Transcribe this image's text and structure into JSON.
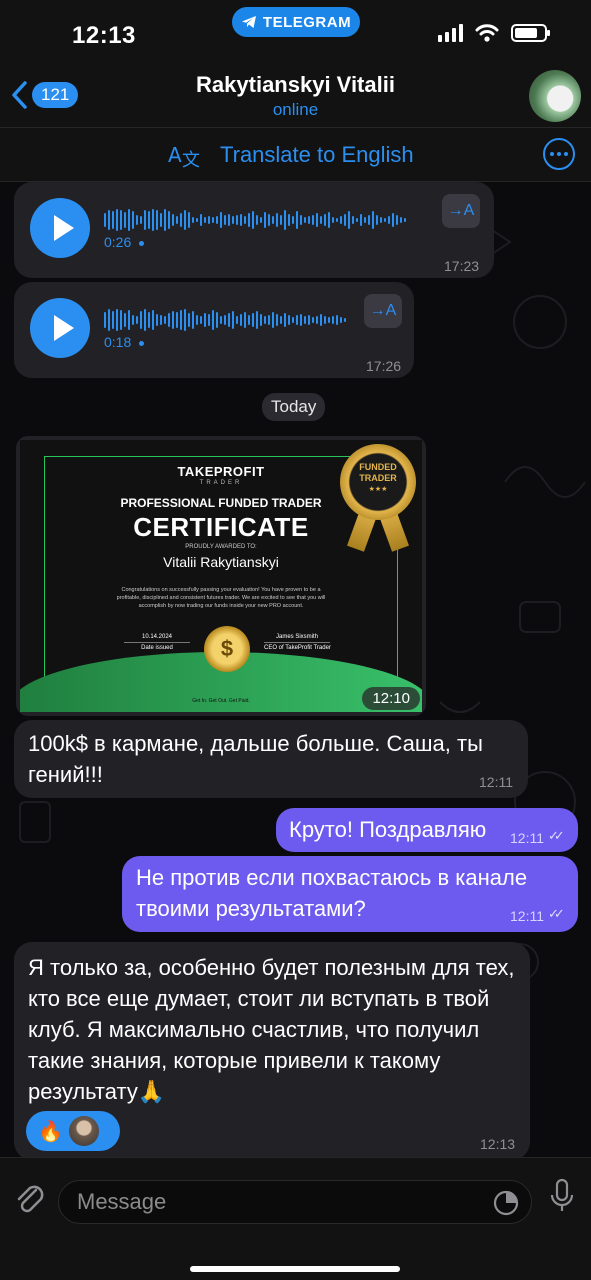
{
  "status": {
    "time": "12:13",
    "app_pill": "TELEGRAM"
  },
  "header": {
    "back_count": "121",
    "title": "Rakytianskyi Vitalii",
    "status": "online"
  },
  "translate_bar": {
    "label": "Translate to English"
  },
  "voice_messages": [
    {
      "duration": "0:26",
      "time": "17:23",
      "translate": "→A"
    },
    {
      "duration": "0:18",
      "time": "17:26",
      "translate": "→A"
    }
  ],
  "date_divider": "Today",
  "certificate": {
    "brand": "TAKEPROFIT",
    "brand_sub": "TRADER",
    "subtitle": "PROFESSIONAL FUNDED TRADER",
    "title": "CERTIFICATE",
    "awarded": "PROUDLY AWARDED TO:",
    "name": "Vitalii Rakytianskyi",
    "body": "Congratulations on successfully passing your evaluation! You have proven to be a profitable, disciplined and consistent futures trader. We are excited to see that you will accomplish by now trading our funds inside your new PRO account.",
    "date": "10.14.2024",
    "date_label": "Date issued",
    "signer": "James Sixsmith",
    "signer_label": "CEO of TakeProfit Trader",
    "seal_line1": "FUNDED",
    "seal_line2": "TRADER",
    "seal_stars": "★★★",
    "coin": "$",
    "footer": "Get In. Get Out. Get Paid.",
    "time": "12:10"
  },
  "messages": [
    {
      "dir": "in",
      "text": "100k$ в кармане, дальше больше. Саша, ты гений!!!",
      "time": "12:11"
    },
    {
      "dir": "out",
      "text": "Круто! Поздравляю",
      "time": "12:11"
    },
    {
      "dir": "out",
      "text": "Не против если похвастаюсь в канале твоими результатами?",
      "time": "12:11"
    },
    {
      "dir": "in",
      "text": "Я только за, особенно будет полезным для тех, кто все еще думает, стоит ли вступать в твой клуб. Я максимально счастлив, что получил такие знания, которые привели к такому результату🙏",
      "time": "12:13"
    }
  ],
  "reaction": {
    "emoji": "🔥"
  },
  "input": {
    "placeholder": "Message"
  },
  "colors": {
    "accent": "#2a8ff0",
    "outgoing": "#6d5bef",
    "incoming": "#222126"
  }
}
